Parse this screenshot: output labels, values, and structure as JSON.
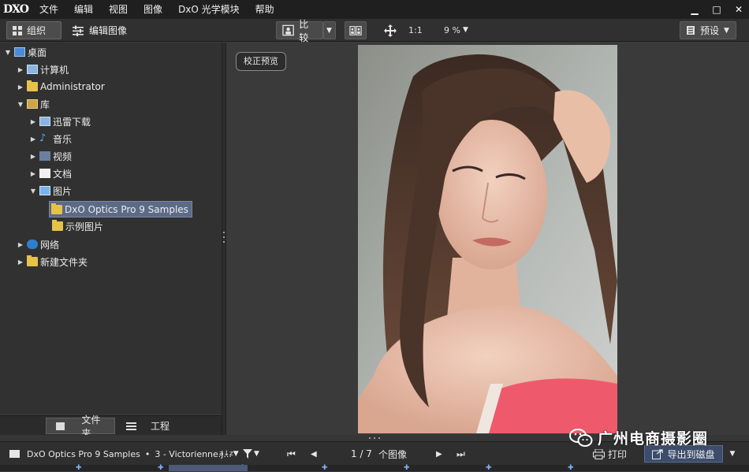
{
  "app": {
    "logo": "DXO"
  },
  "menu": [
    "文件",
    "编辑",
    "视图",
    "图像",
    "DxO 光学模块",
    "帮助"
  ],
  "window_controls": {
    "minimize": "▁",
    "restore": "□",
    "close": "✕"
  },
  "toolbar": {
    "organize": "组织",
    "edit_image": "编辑图像",
    "compare": "比较",
    "zoom_ratio": "1:1",
    "zoom_level": "9 %",
    "presets": "预设"
  },
  "tree": [
    {
      "label": "桌面",
      "depth": 0,
      "expanded": true,
      "icon": "desktop-icon"
    },
    {
      "label": "计算机",
      "depth": 1,
      "expanded": false,
      "icon": "computer-icon"
    },
    {
      "label": "Administrator",
      "depth": 1,
      "expanded": false,
      "icon": "folder-icon"
    },
    {
      "label": "库",
      "depth": 1,
      "expanded": true,
      "icon": "library-icon"
    },
    {
      "label": "迅雷下载",
      "depth": 2,
      "expanded": false,
      "icon": "download-icon"
    },
    {
      "label": "音乐",
      "depth": 2,
      "expanded": false,
      "icon": "music-icon"
    },
    {
      "label": "视频",
      "depth": 2,
      "expanded": false,
      "icon": "video-icon"
    },
    {
      "label": "文档",
      "depth": 2,
      "expanded": false,
      "icon": "document-icon"
    },
    {
      "label": "图片",
      "depth": 2,
      "expanded": true,
      "icon": "pictures-icon"
    },
    {
      "label": "DxO Optics Pro 9 Samples",
      "depth": 3,
      "selected": true,
      "icon": "folder-icon"
    },
    {
      "label": "示例图片",
      "depth": 3,
      "icon": "folder-icon"
    },
    {
      "label": "网络",
      "depth": 1,
      "expanded": false,
      "icon": "network-icon"
    },
    {
      "label": "新建文件夹",
      "depth": 1,
      "expanded": false,
      "icon": "folder-icon"
    }
  ],
  "panel_tabs": {
    "folders": "文件夹",
    "projects": "工程"
  },
  "viewer": {
    "correction_preview": "校正预览"
  },
  "bottombar": {
    "path": "DxO Optics Pro 9 Samples",
    "bullet": "•",
    "file": "3 - Victorienne.j...",
    "sort": "a↓z",
    "counter": "1 / 7",
    "images_label": "个图像",
    "print": "打印",
    "export": "导出到磁盘"
  },
  "watermark": {
    "text": "广州电商摄影圈"
  },
  "colors": {
    "menubar": "#1f1f1f",
    "panel": "#313131",
    "viewer": "#3a3a3a",
    "selection": "#5d6a85",
    "export": "#3c4c6a"
  }
}
